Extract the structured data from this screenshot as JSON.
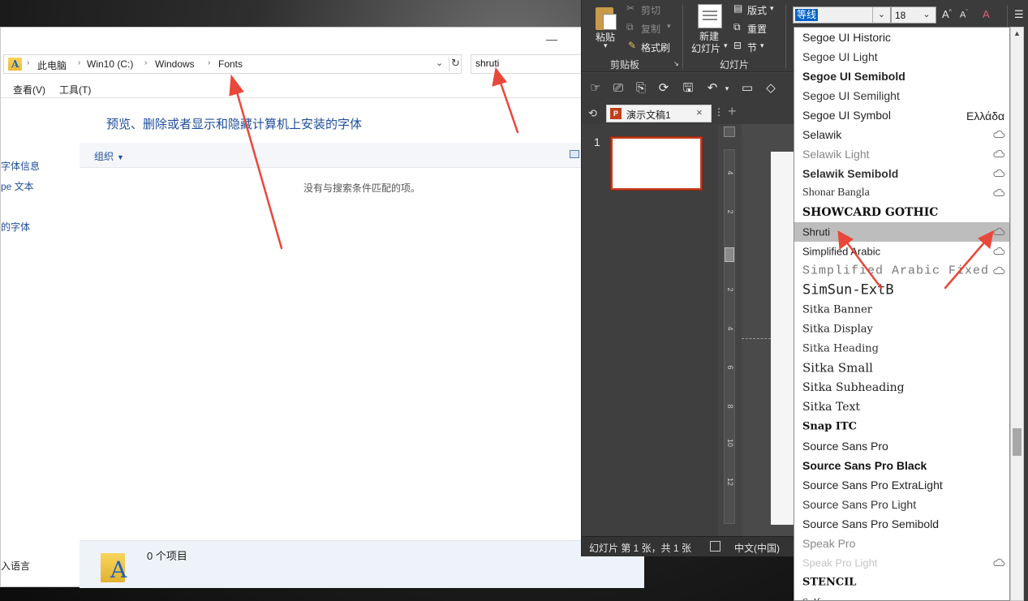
{
  "explorer": {
    "breadcrumb": [
      "此电脑",
      "Win10 (C:)",
      "Windows",
      "Fonts"
    ],
    "search_value": "shruti",
    "menu": [
      "查看(V)",
      "工具(T)"
    ],
    "heading": "预览、删除或者显示和隐藏计算机上安装的字体",
    "left_links": [
      "字体信息",
      "pe 文本",
      "的字体"
    ],
    "organize_label": "组织",
    "empty_message": "没有与搜索条件匹配的项。",
    "item_count": "0 个项目",
    "lang_link": "入语言"
  },
  "ppt": {
    "clipboard": {
      "paste": "粘贴",
      "cut": "剪切",
      "copy": "复制",
      "format_painter": "格式刷",
      "group": "剪贴板"
    },
    "slides": {
      "new_slide_1": "新建",
      "new_slide_2": "幻灯片",
      "layout": "版式",
      "reset": "重置",
      "section": "节",
      "group": "幻灯片"
    },
    "font_name": "等线",
    "font_size": "18",
    "doc_tab": "演示文稿1",
    "slide_number": "1",
    "ruler_labels": [
      "4",
      "2",
      "0",
      "2",
      "4",
      "6",
      "8",
      "10",
      "12"
    ],
    "status": {
      "slide_count": "幻灯片 第 1 张，共 1 张",
      "language": "中文(中国)"
    }
  },
  "font_list": [
    {
      "name": "Segoe UI Historic",
      "family": "Liberation Sans, sans-serif",
      "size": 14,
      "weight": "normal",
      "color": "#222"
    },
    {
      "name": "Segoe UI Light",
      "family": "Liberation Sans, sans-serif",
      "size": 14,
      "weight": "normal",
      "color": "#333"
    },
    {
      "name": "Segoe UI Semibold",
      "family": "Liberation Sans, sans-serif",
      "size": 14,
      "weight": "bold",
      "color": "#222"
    },
    {
      "name": "Segoe UI Semilight",
      "family": "Liberation Sans, sans-serif",
      "size": 14,
      "weight": "normal",
      "color": "#333"
    },
    {
      "name": "Segoe UI Symbol",
      "family": "Liberation Sans, sans-serif",
      "size": 14,
      "weight": "normal",
      "color": "#222",
      "preview": "Ελλάδα"
    },
    {
      "name": "Selawik",
      "family": "Liberation Sans, sans-serif",
      "size": 14,
      "weight": "normal",
      "color": "#222",
      "cloud": true
    },
    {
      "name": "Selawik Light",
      "family": "Liberation Sans, sans-serif",
      "size": 14,
      "weight": "normal",
      "color": "#888",
      "cloud": true
    },
    {
      "name": "Selawik Semibold",
      "family": "Liberation Sans, sans-serif",
      "size": 14,
      "weight": "bold",
      "color": "#333",
      "cloud": true
    },
    {
      "name": "Shonar Bangla",
      "family": "Liberation Serif, serif",
      "size": 14,
      "weight": "normal",
      "color": "#333",
      "cloud": true
    },
    {
      "name": "SHOWCARD GOTHIC",
      "family": "DejaVu Serif, serif",
      "size": 14,
      "weight": "bold",
      "color": "#111"
    },
    {
      "name": "Shruti",
      "family": "Liberation Sans, sans-serif",
      "size": 13,
      "weight": "normal",
      "color": "#222",
      "cloud": true,
      "selected": true
    },
    {
      "name": "Simplified Arabic",
      "family": "Liberation Sans, sans-serif",
      "size": 13,
      "weight": "normal",
      "color": "#222",
      "cloud": true
    },
    {
      "name": "Simplified Arabic Fixed",
      "family": "Liberation Mono, monospace",
      "size": 15,
      "weight": "normal",
      "color": "#777",
      "cloud": true
    },
    {
      "name": "SimSun-ExtB",
      "family": "DejaVu Sans Mono, monospace",
      "size": 17,
      "weight": "normal",
      "color": "#222"
    },
    {
      "name": "Sitka Banner",
      "family": "DejaVu Serif, serif",
      "size": 13,
      "weight": "normal",
      "color": "#222"
    },
    {
      "name": "Sitka Display",
      "family": "DejaVu Serif, serif",
      "size": 13,
      "weight": "normal",
      "color": "#222"
    },
    {
      "name": "Sitka Heading",
      "family": "DejaVu Serif, serif",
      "size": 13,
      "weight": "normal",
      "color": "#333"
    },
    {
      "name": "Sitka Small",
      "family": "DejaVu Serif, serif",
      "size": 15,
      "weight": "normal",
      "color": "#222"
    },
    {
      "name": "Sitka Subheading",
      "family": "DejaVu Serif, serif",
      "size": 14,
      "weight": "normal",
      "color": "#222"
    },
    {
      "name": "Sitka Text",
      "family": "DejaVu Serif, serif",
      "size": 14,
      "weight": "normal",
      "color": "#222"
    },
    {
      "name": "Snap ITC",
      "family": "DejaVu Serif, serif",
      "size": 13,
      "weight": "bold",
      "color": "#111"
    },
    {
      "name": "Source Sans Pro",
      "family": "Liberation Sans, sans-serif",
      "size": 14,
      "weight": "normal",
      "color": "#222"
    },
    {
      "name": "Source Sans Pro Black",
      "family": "Liberation Sans, sans-serif",
      "size": 14,
      "weight": "bold",
      "color": "#111"
    },
    {
      "name": "Source Sans Pro ExtraLight",
      "family": "Liberation Sans, sans-serif",
      "size": 14,
      "weight": "normal",
      "color": "#222"
    },
    {
      "name": "Source Sans Pro Light",
      "family": "Liberation Sans, sans-serif",
      "size": 14,
      "weight": "normal",
      "color": "#333"
    },
    {
      "name": "Source Sans Pro Semibold",
      "family": "Liberation Sans, sans-serif",
      "size": 14,
      "weight": "normal",
      "color": "#222"
    },
    {
      "name": "Speak Pro",
      "family": "Liberation Sans, sans-serif",
      "size": 14,
      "weight": "normal",
      "color": "#888"
    },
    {
      "name": "Speak Pro Light",
      "family": "Liberation Sans, sans-serif",
      "size": 13,
      "weight": "normal",
      "color": "#c4c4c4",
      "cloud": true
    },
    {
      "name": "STENCIL",
      "family": "DejaVu Serif, serif",
      "size": 13,
      "weight": "bold",
      "color": "#111"
    },
    {
      "name": "Sylfaen",
      "family": "Liberation Serif, serif",
      "size": 13,
      "weight": "normal",
      "color": "#222"
    }
  ],
  "colors": {
    "accent": "#1f4e9a",
    "selection": "#0063c6",
    "annotation_arrow": "#e8483a",
    "ppt_brand": "#c43e1c"
  }
}
